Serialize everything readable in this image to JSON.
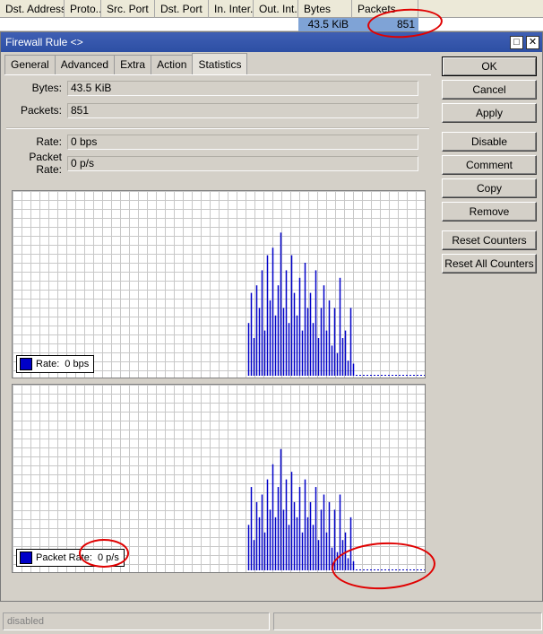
{
  "table": {
    "columns": [
      "Dst. Address",
      "Proto...",
      "Src. Port",
      "Dst. Port",
      "In. Inter...",
      "Out. Int...",
      "Bytes",
      "Packets"
    ],
    "row": {
      "bytes": "43.5 KiB",
      "packets": "851"
    }
  },
  "dialog": {
    "title": "Firewall Rule <>",
    "tabs": [
      "General",
      "Advanced",
      "Extra",
      "Action",
      "Statistics"
    ],
    "active_tab": "Statistics",
    "fields": {
      "bytes_label": "Bytes:",
      "bytes_value": "43.5 KiB",
      "packets_label": "Packets:",
      "packets_value": "851",
      "rate_label": "Rate:",
      "rate_value": "0 bps",
      "packet_rate_label": "Packet Rate:",
      "packet_rate_value": "0 p/s"
    },
    "buttons": [
      "OK",
      "Cancel",
      "Apply",
      "Disable",
      "Comment",
      "Copy",
      "Remove",
      "Reset Counters",
      "Reset All Counters"
    ],
    "graphs": {
      "rate": {
        "legend_label": "Rate:",
        "legend_value": "0 bps",
        "color": "#0000c8"
      },
      "packet_rate": {
        "legend_label": "Packet Rate:",
        "legend_value": "0 p/s",
        "color": "#0000c8"
      }
    },
    "status": "disabled"
  },
  "colors": {
    "title_bar": "#2d4fa4",
    "bar": "#0000c8",
    "annotation": "#e00000",
    "selected_row": "#7fa3d6"
  }
}
